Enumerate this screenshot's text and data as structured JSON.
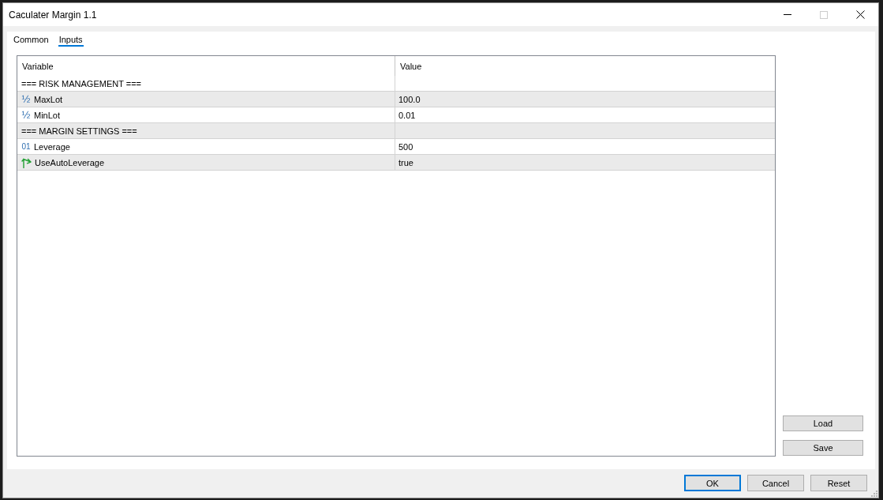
{
  "window": {
    "title": "Caculater Margin 1.1",
    "maximize_disabled": true
  },
  "tabs": [
    {
      "label": "Common",
      "selected": false
    },
    {
      "label": "Inputs",
      "selected": true
    }
  ],
  "table": {
    "columns": [
      "Variable",
      "Value"
    ],
    "rows": [
      {
        "kind": "group",
        "variable": "=== RISK MANAGEMENT ==="
      },
      {
        "kind": "double",
        "type_mark": "½",
        "variable": "MaxLot",
        "value": "100.0"
      },
      {
        "kind": "double",
        "type_mark": "½",
        "variable": "MinLot",
        "value": "0.01"
      },
      {
        "kind": "group",
        "variable": "=== MARGIN SETTINGS ==="
      },
      {
        "kind": "integer",
        "type_mark": "01",
        "variable": "Leverage",
        "value": "500"
      },
      {
        "kind": "bool",
        "variable": "UseAutoLeverage",
        "value": "true"
      }
    ]
  },
  "side_buttons": [
    "Load",
    "Save"
  ],
  "buttons": [
    {
      "label": "OK",
      "default": true
    },
    {
      "label": "Cancel",
      "default": false
    },
    {
      "label": "Reset",
      "default": false
    }
  ]
}
